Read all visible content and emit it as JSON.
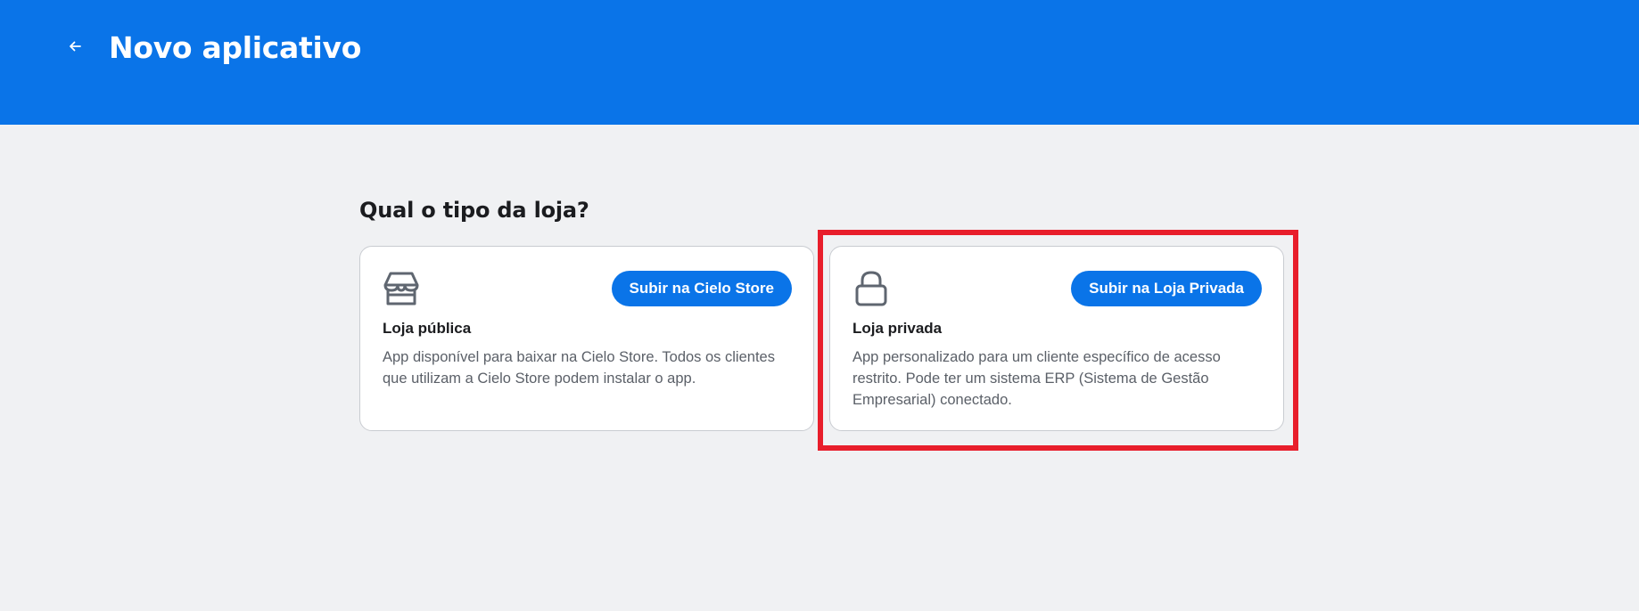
{
  "header": {
    "title": "Novo aplicativo",
    "back_icon": "arrow-left-icon",
    "background_color": "#0a74e8"
  },
  "main": {
    "question": "Qual o tipo da loja?",
    "cards": [
      {
        "icon": "store-icon",
        "button_label": "Subir na Cielo Store",
        "title": "Loja pública",
        "description": "App disponível para baixar na Cielo Store. Todos os clientes que utilizam a Cielo Store podem instalar o app."
      },
      {
        "icon": "lock-icon",
        "button_label": "Subir na Loja Privada",
        "title": "Loja privada",
        "description": "App personalizado para um cliente específico de acesso restrito. Pode ter um sistema ERP (Sistema de Gestão Empresarial) conectado."
      }
    ]
  },
  "colors": {
    "accent": "#0a74e8",
    "highlight": "#e81e2b",
    "page_background": "#f0f1f3"
  }
}
